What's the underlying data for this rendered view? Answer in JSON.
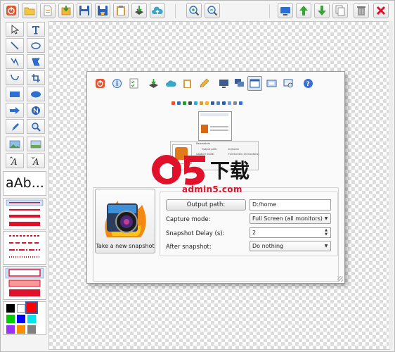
{
  "watermark": {
    "main": "下载",
    "sub": "admin5.com"
  },
  "text_tool_sample": "aAb...",
  "options": {
    "output_path_button": "Output path:",
    "output_path_value": "D:/home",
    "capture_mode_label": "Capture mode:",
    "capture_mode_value": "Full Screen (all monitors)",
    "snapshot_delay_label": "Snapshot Delay (s):",
    "snapshot_delay_value": "2",
    "after_snapshot_label": "After snapshot:",
    "after_snapshot_value": "Do nothing"
  },
  "snapshot_button_label": "Take a new snapshot",
  "thumbnail": {
    "header": "Parameters",
    "rows": [
      "Output path:",
      "D:/home",
      "Capture mode:",
      "Full Screen (all monitors)"
    ]
  },
  "colors": {
    "palette": [
      "#000000",
      "#ffffff",
      "#ff0000",
      "#00cc00",
      "#0000ff",
      "#00e5ee",
      "#9b30ff",
      "#ff8c00",
      "#808080"
    ],
    "accent_red": "#e0122b",
    "accent_blue": "#2c6fd1",
    "accent_green": "#3aa33a"
  },
  "icons": {
    "top_toolbar": [
      "power",
      "open-folder",
      "new-file",
      "import",
      "save",
      "save-as",
      "clipboard",
      "export",
      "upload-cloud",
      "zoom-fit",
      "zoom-reset",
      "screen",
      "move-up",
      "move-down",
      "copy",
      "trash",
      "close"
    ],
    "inner_toolbar": [
      "power",
      "info",
      "checklist",
      "layers",
      "cloud",
      "clipboard",
      "pencil",
      "monitor",
      "monitors",
      "window",
      "window-frame",
      "region",
      "help"
    ]
  }
}
